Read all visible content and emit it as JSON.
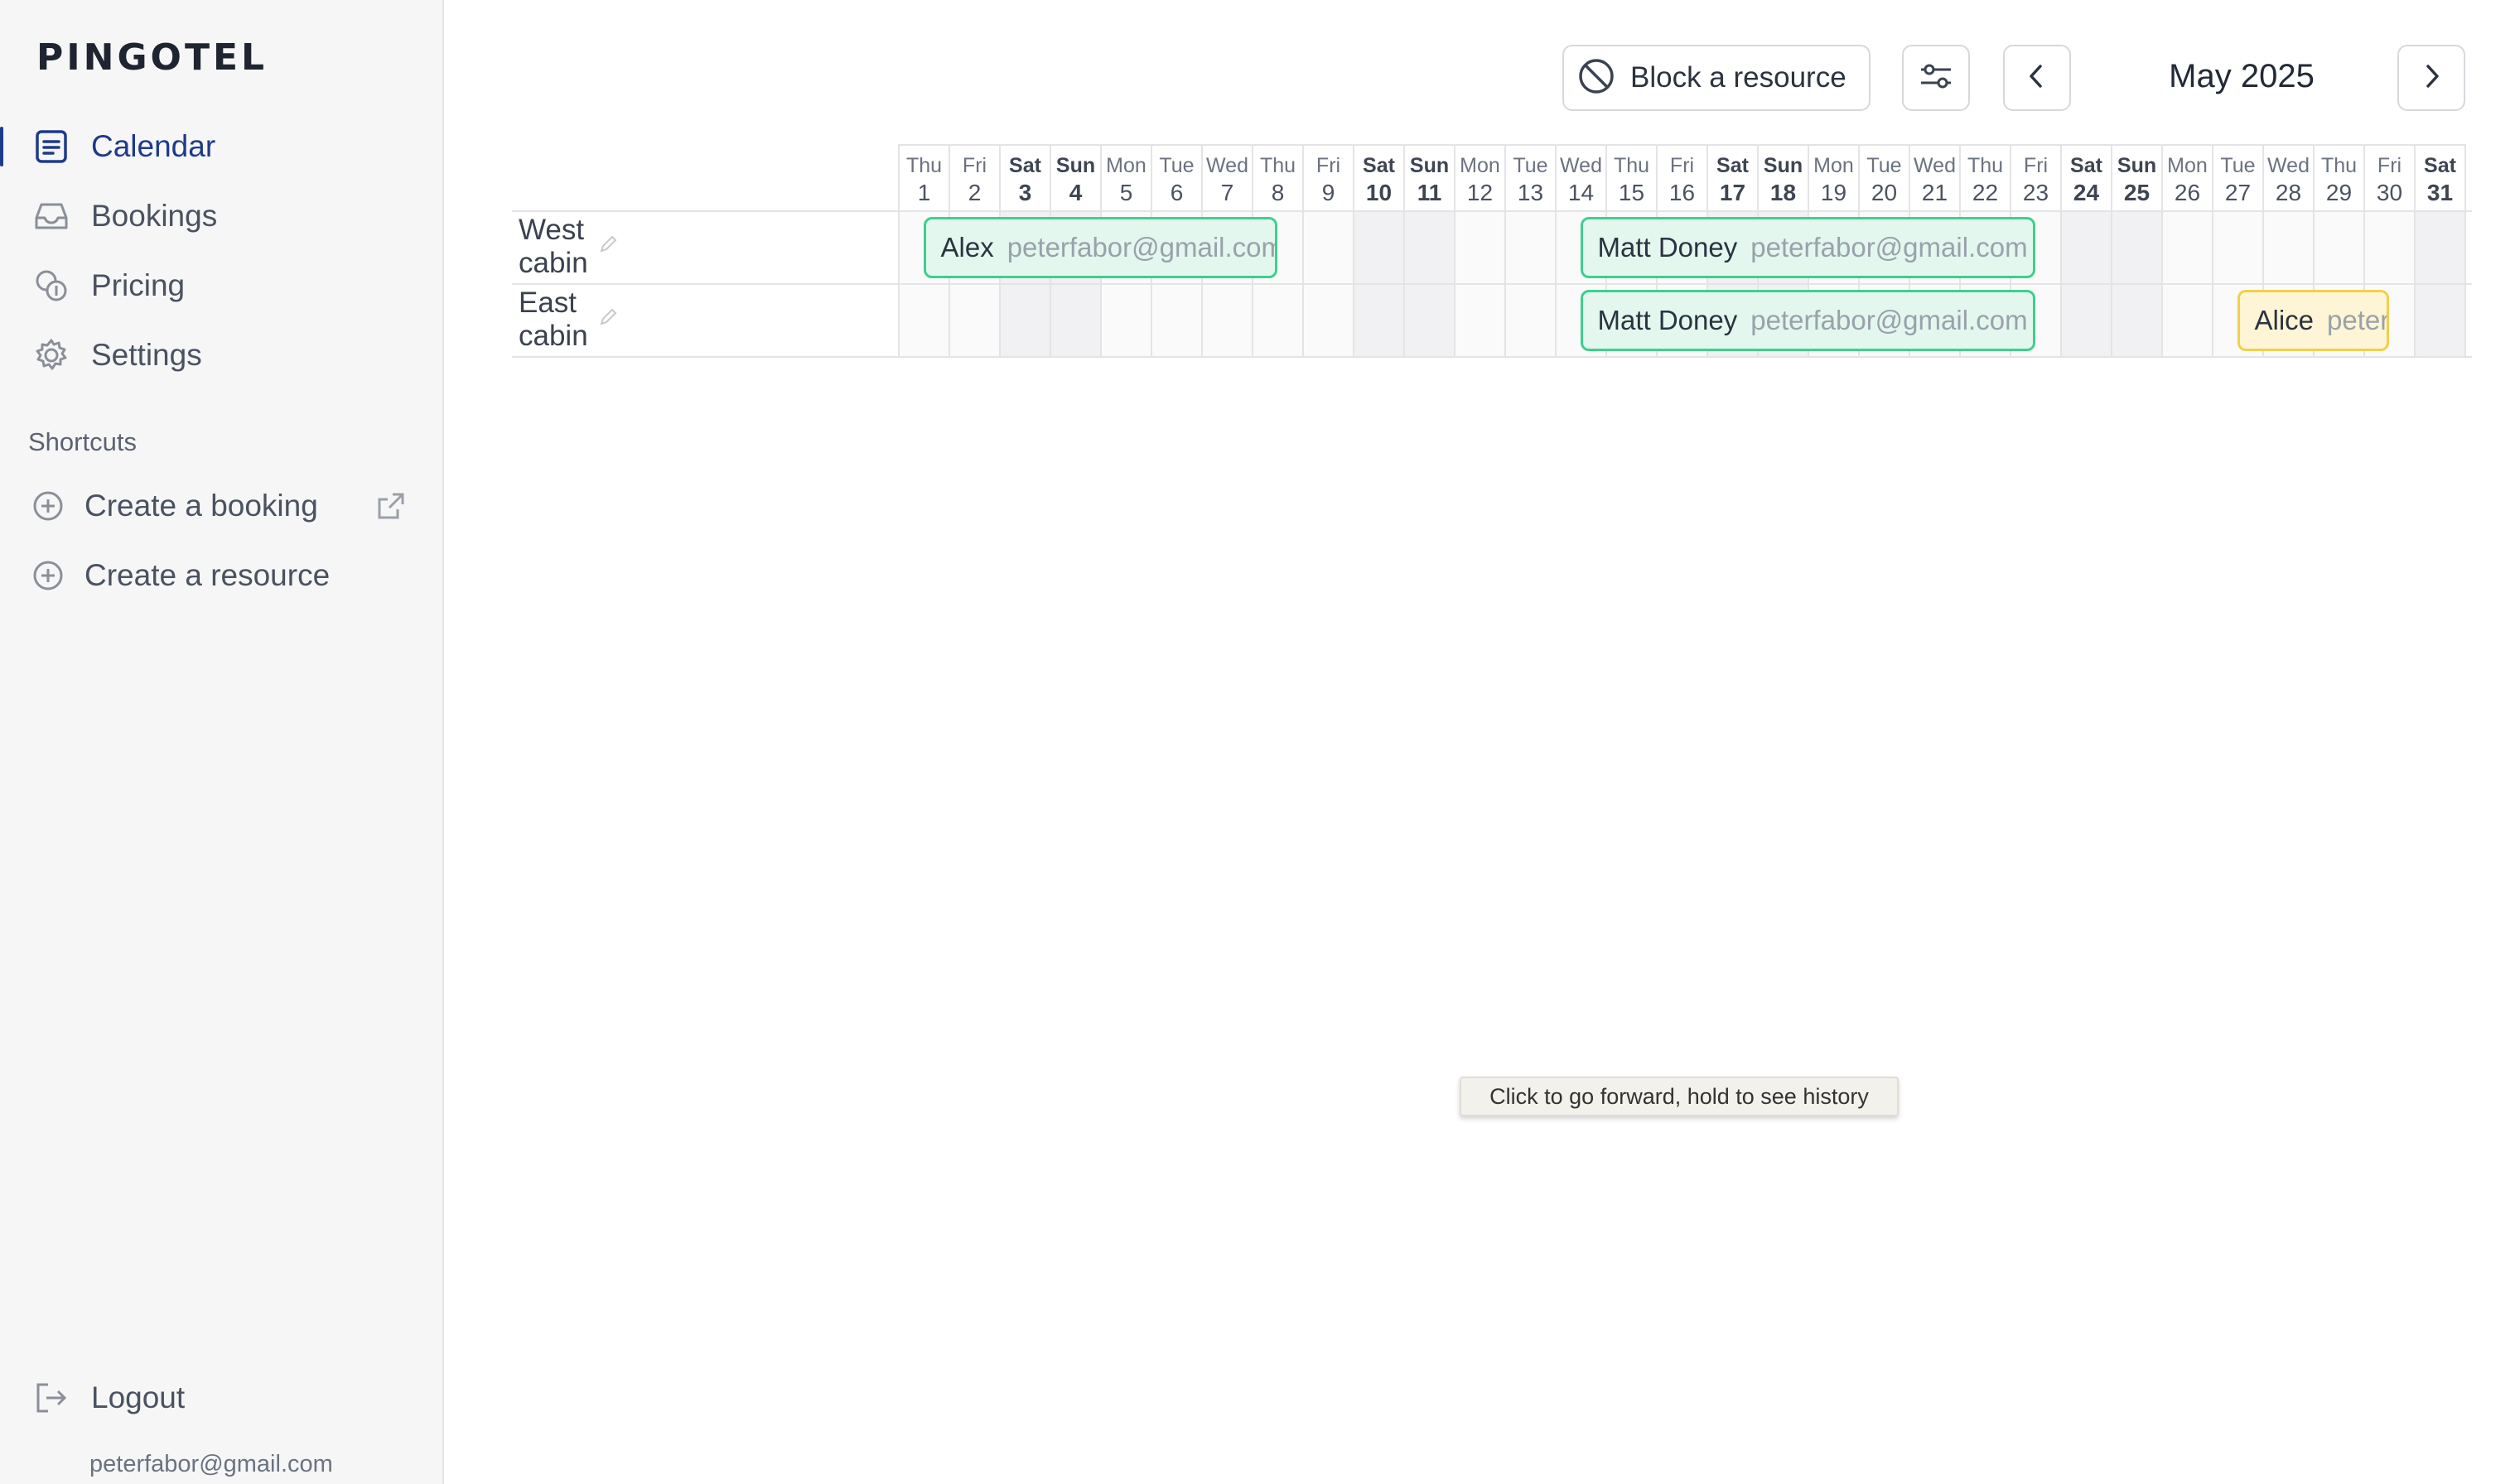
{
  "app": {
    "logo": "PINGOTEL"
  },
  "sidebar": {
    "nav": [
      {
        "label": "Calendar",
        "icon": "calendar-list-icon",
        "active": true
      },
      {
        "label": "Bookings",
        "icon": "inbox-icon",
        "active": false
      },
      {
        "label": "Pricing",
        "icon": "coins-icon",
        "active": false
      },
      {
        "label": "Settings",
        "icon": "gear-icon",
        "active": false
      }
    ],
    "shortcuts_title": "Shortcuts",
    "shortcuts": [
      {
        "label": "Create a booking",
        "icon": "plus-circle-icon",
        "external": true
      },
      {
        "label": "Create a resource",
        "icon": "plus-circle-icon",
        "external": false
      }
    ],
    "logout_label": "Logout",
    "user_email": "peterfabor@gmail.com"
  },
  "toolbar": {
    "block_label": "Block a resource",
    "month_label": "May 2025"
  },
  "calendar": {
    "days": [
      {
        "name": "Thu",
        "date": "1"
      },
      {
        "name": "Fri",
        "date": "2"
      },
      {
        "name": "Sat",
        "date": "3"
      },
      {
        "name": "Sun",
        "date": "4"
      },
      {
        "name": "Mon",
        "date": "5"
      },
      {
        "name": "Tue",
        "date": "6"
      },
      {
        "name": "Wed",
        "date": "7"
      },
      {
        "name": "Thu",
        "date": "8"
      },
      {
        "name": "Fri",
        "date": "9"
      },
      {
        "name": "Sat",
        "date": "10"
      },
      {
        "name": "Sun",
        "date": "11"
      },
      {
        "name": "Mon",
        "date": "12"
      },
      {
        "name": "Tue",
        "date": "13"
      },
      {
        "name": "Wed",
        "date": "14"
      },
      {
        "name": "Thu",
        "date": "15"
      },
      {
        "name": "Fri",
        "date": "16"
      },
      {
        "name": "Sat",
        "date": "17"
      },
      {
        "name": "Sun",
        "date": "18"
      },
      {
        "name": "Mon",
        "date": "19"
      },
      {
        "name": "Tue",
        "date": "20"
      },
      {
        "name": "Wed",
        "date": "21"
      },
      {
        "name": "Thu",
        "date": "22"
      },
      {
        "name": "Fri",
        "date": "23"
      },
      {
        "name": "Sat",
        "date": "24"
      },
      {
        "name": "Sun",
        "date": "25"
      },
      {
        "name": "Mon",
        "date": "26"
      },
      {
        "name": "Tue",
        "date": "27"
      },
      {
        "name": "Wed",
        "date": "28"
      },
      {
        "name": "Thu",
        "date": "29"
      },
      {
        "name": "Fri",
        "date": "30"
      },
      {
        "name": "Sat",
        "date": "31"
      }
    ],
    "resources": [
      {
        "name": "West cabin",
        "bookings": [
          {
            "guest": "Alex",
            "email": "peterfabor@gmail.com",
            "start_day": 1.5,
            "end_day": 8.5,
            "status": "green"
          },
          {
            "guest": "Matt Doney",
            "email": "peterfabor@gmail.com",
            "start_day": 14.5,
            "end_day": 23.5,
            "status": "green"
          }
        ]
      },
      {
        "name": "East cabin",
        "bookings": [
          {
            "guest": "Matt Doney",
            "email": "peterfabor@gmail.com",
            "start_day": 14.5,
            "end_day": 23.5,
            "status": "green"
          },
          {
            "guest": "Alice",
            "email": "peterfabor@gmail.com",
            "start_day": 27.5,
            "end_day": 30.5,
            "status": "yellow"
          }
        ]
      }
    ]
  },
  "tooltip": {
    "text": "Click to go forward, hold to see history"
  },
  "colors": {
    "accent": "#1e3a8a",
    "booking_green_border": "#3fcf8e",
    "booking_yellow_border": "#f1d04b"
  }
}
